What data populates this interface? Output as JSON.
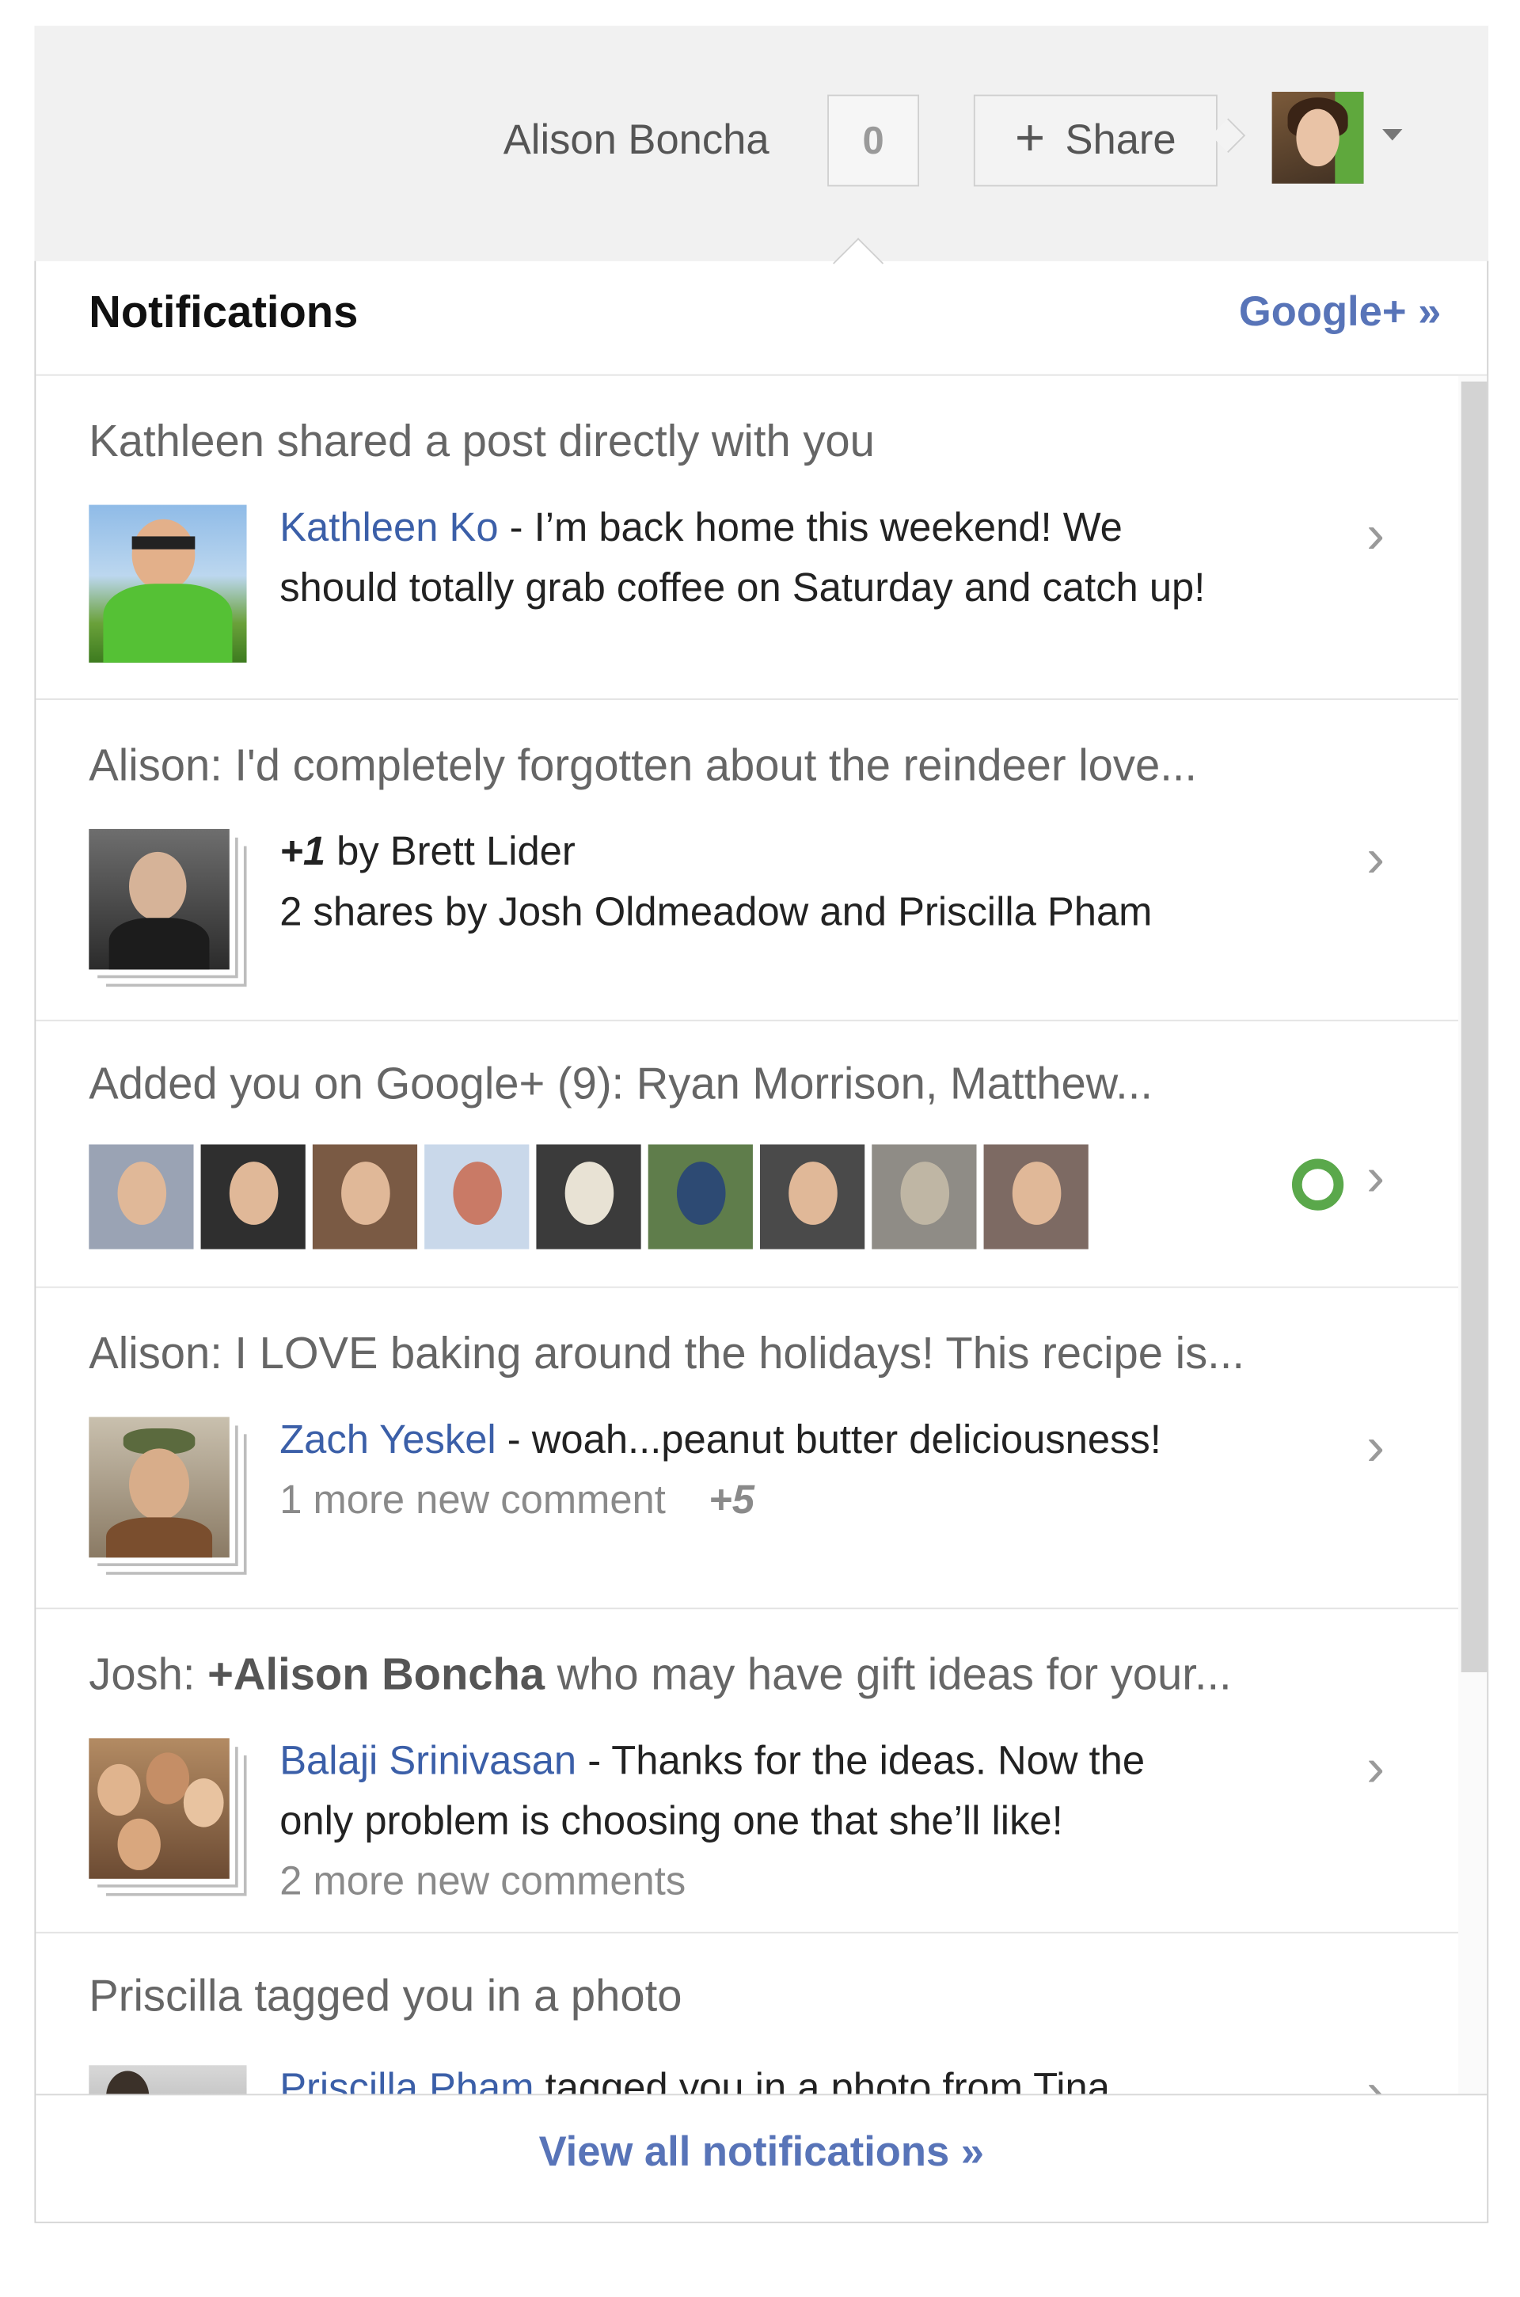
{
  "header": {
    "user_name": "Alison Boncha",
    "notification_count": "0",
    "share_plus": "+",
    "share_label": "Share"
  },
  "panel": {
    "title": "Notifications",
    "gplus_link": "Google+ »",
    "footer_link": "View all notifications »"
  },
  "items": [
    {
      "title": "Kathleen shared a post directly with you",
      "name": "Kathleen Ko",
      "text": " - I’m back home this weekend! We",
      "text2": "should totally grab coffee on Saturday and catch up!"
    },
    {
      "title": "Alison: I'd completely forgotten about the reindeer love...",
      "plus": "+1",
      "line1": " by Brett Lider",
      "line2": "2 shares by Josh Oldmeadow and Priscilla Pham"
    },
    {
      "title": "Added you on Google+ (9): Ryan Morrison, Matthew..."
    },
    {
      "title": "Alison: I LOVE baking around the holidays! This recipe is...",
      "name": "Zach Yeskel",
      "text": " - woah...peanut butter deliciousness!",
      "more": "1 more new comment",
      "plus": "+5"
    },
    {
      "title_prefix": "Josh: ",
      "title_bold": "+Alison Boncha",
      "title_suffix": " who may have gift ideas for your...",
      "name": "Balaji Srinivasan",
      "text": "  - Thanks for the ideas. Now the",
      "text2": "only problem is choosing one that she’ll like!",
      "more": "2 more new comments"
    },
    {
      "title": "Priscilla tagged you in a photo",
      "name": "Priscilla Pham",
      "text": " tagged you in a photo from Tina"
    }
  ],
  "chevron": "›"
}
